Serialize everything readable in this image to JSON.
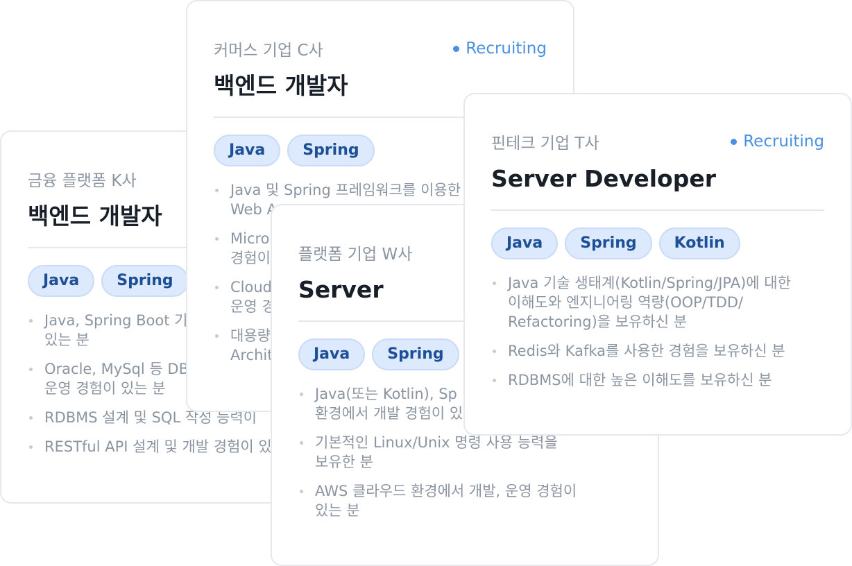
{
  "accent_color": "#4a90e2",
  "cards": [
    {
      "company": "금융 플랫폼 K사",
      "status": "",
      "title": "백엔드 개발자",
      "tags": [
        "Java",
        "Spring"
      ],
      "requirements": [
        "Java, Spring Boot 기\n있는 분",
        "Oracle, MySql 등 DB\n운영 경험이 있는 분",
        "RDBMS 설계 및 SQL 작성 능력이",
        "RESTful API 설계 및 개발 경험이 있"
      ]
    },
    {
      "company": "커머스 기업 C사",
      "status": "Recruiting",
      "title": "백엔드 개발자",
      "tags": [
        "Java",
        "Spring"
      ],
      "requirements": [
        "Java 및 Spring 프레임워크를 이용한\nWeb A",
        "Micro\n경험이",
        "Cloud\n운영 경",
        "대용량\nArchit"
      ]
    },
    {
      "company": "플랫폼 기업 W사",
      "status": "",
      "title": "Server",
      "tags": [
        "Java",
        "Spring",
        ""
      ],
      "requirements": [
        "Java(또는 Kotlin), Sp\n환경에서 개발 경험이 있",
        "기본적인 Linux/Unix 명령 사용 능력을\n보유한 분",
        "AWS 클라우드 환경에서 개발, 운영 경험이\n있는 분"
      ]
    },
    {
      "company": "핀테크 기업 T사",
      "status": "Recruiting",
      "title": "Server Developer",
      "tags": [
        "Java",
        "Spring",
        "Kotlin"
      ],
      "requirements": [
        "Java 기술 생태계(Kotlin/Spring/JPA)에 대한\n이해도와 엔지니어링 역량(OOP/TDD/\nRefactoring)을 보유하신 분",
        "Redis와 Kafka를 사용한 경험을 보유하신 분",
        "RDBMS에 대한 높은 이해도를 보유하신 분"
      ]
    }
  ]
}
